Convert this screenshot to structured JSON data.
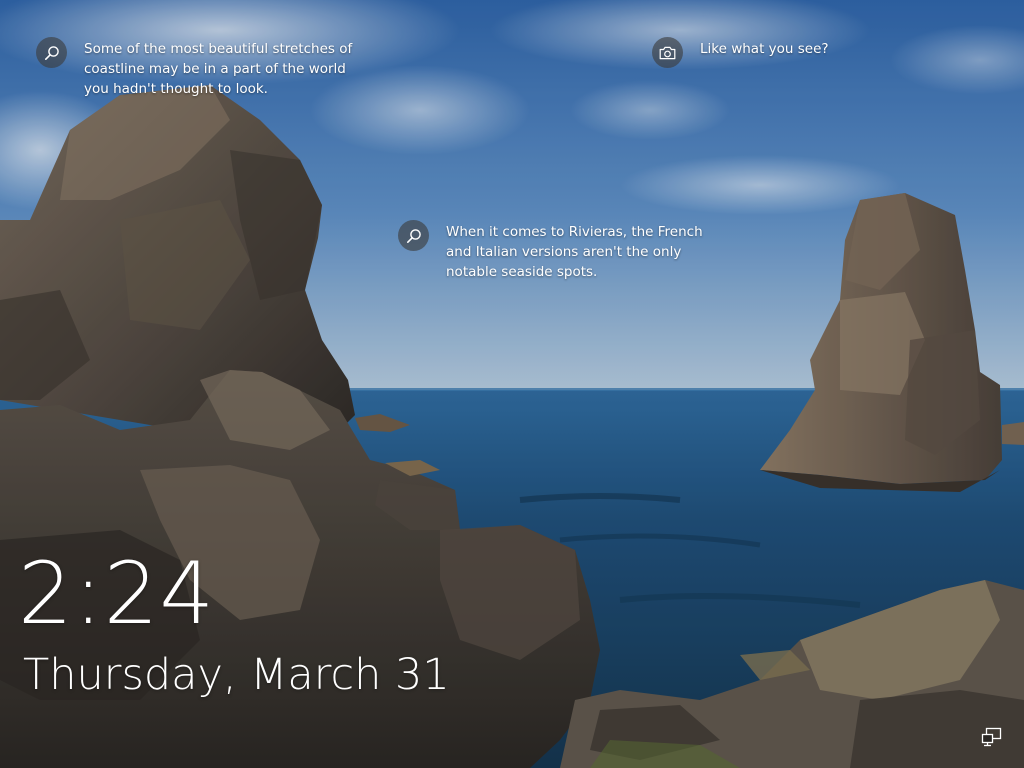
{
  "lockscreen": {
    "spotlight": [
      {
        "icon": "search-icon",
        "text": "Some of the most beautiful stretches of\ncoastline may be in a part of the world\nyou hadn't thought to look."
      },
      {
        "icon": "search-icon",
        "text": "When it comes to Rivieras, the French\nand Italian versions aren't the only\nnotable seaside spots."
      },
      {
        "icon": "camera-icon",
        "text": "Like what you see?"
      }
    ],
    "time": "2:24",
    "date": "Thursday, March 31",
    "status_icon": "network-icon"
  },
  "colors": {
    "sky_top": "#3f73b2",
    "sky_horizon": "#a9c3d9",
    "sea": "#1f4f78",
    "rock": "#5d544c",
    "text": "#ffffff"
  }
}
